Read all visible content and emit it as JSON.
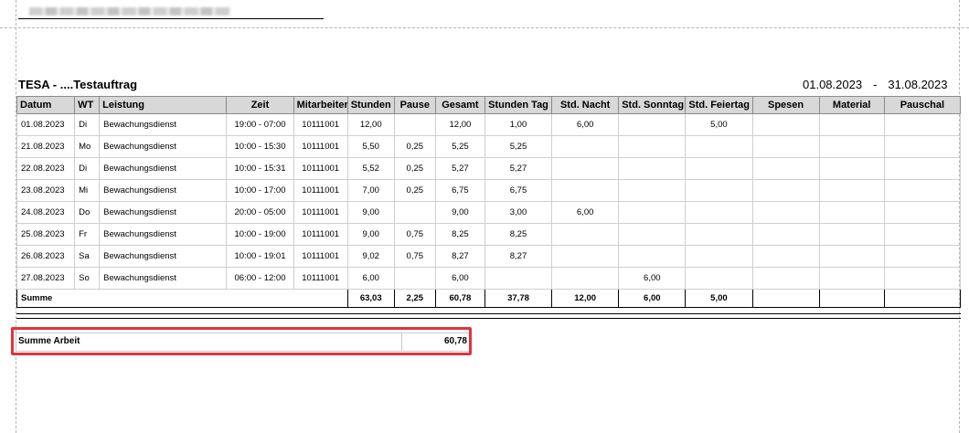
{
  "report": {
    "title": "TESA - ....Testauftrag",
    "date_from": "01.08.2023",
    "date_separator": "-",
    "date_to": "31.08.2023"
  },
  "table": {
    "headers": [
      "Datum",
      "WT",
      "Leistung",
      "Zeit",
      "Mitarbeiter",
      "Stunden",
      "Pause",
      "Gesamt",
      "Stunden Tag",
      "Std. Nacht",
      "Std. Sonntag",
      "Std. Feiertag",
      "Spesen",
      "Material",
      "Pauschal"
    ],
    "rows": [
      [
        "01.08.2023",
        "Di",
        "Bewachungsdienst",
        "19:00 - 07:00",
        "10111001",
        "12,00",
        "",
        "12,00",
        "1,00",
        "6,00",
        "",
        "5,00",
        "",
        "",
        ""
      ],
      [
        "21.08.2023",
        "Mo",
        "Bewachungsdienst",
        "10:00 - 15:30",
        "10111001",
        "5,50",
        "0,25",
        "5,25",
        "5,25",
        "",
        "",
        "",
        "",
        "",
        ""
      ],
      [
        "22.08.2023",
        "Di",
        "Bewachungsdienst",
        "10:00 - 15:31",
        "10111001",
        "5,52",
        "0,25",
        "5,27",
        "5,27",
        "",
        "",
        "",
        "",
        "",
        ""
      ],
      [
        "23.08.2023",
        "Mi",
        "Bewachungsdienst",
        "10:00 - 17:00",
        "10111001",
        "7,00",
        "0,25",
        "6,75",
        "6,75",
        "",
        "",
        "",
        "",
        "",
        ""
      ],
      [
        "24.08.2023",
        "Do",
        "Bewachungsdienst",
        "20:00 - 05:00",
        "10111001",
        "9,00",
        "",
        "9,00",
        "3,00",
        "6,00",
        "",
        "",
        "",
        "",
        ""
      ],
      [
        "25.08.2023",
        "Fr",
        "Bewachungsdienst",
        "10:00 - 19:00",
        "10111001",
        "9,00",
        "0,75",
        "8,25",
        "8,25",
        "",
        "",
        "",
        "",
        "",
        ""
      ],
      [
        "26.08.2023",
        "Sa",
        "Bewachungsdienst",
        "10:00 - 19:01",
        "10111001",
        "9,02",
        "0,75",
        "8,27",
        "8,27",
        "",
        "",
        "",
        "",
        "",
        ""
      ],
      [
        "27.08.2023",
        "So",
        "Bewachungsdienst",
        "06:00 - 12:00",
        "10111001",
        "6,00",
        "",
        "6,00",
        "",
        "",
        "6,00",
        "",
        "",
        "",
        ""
      ]
    ],
    "sum": {
      "label": "Summe",
      "stunden": "63,03",
      "pause": "2,25",
      "gesamt": "60,78",
      "stunden_tag": "37,78",
      "std_nacht": "12,00",
      "std_sonntag": "6,00",
      "std_feiertag": "5,00"
    }
  },
  "summary": {
    "label": "Summe Arbeit",
    "value": "60,78"
  },
  "colors": {
    "highlight": "#e0343c",
    "header_bg": "#d8d8d8"
  }
}
